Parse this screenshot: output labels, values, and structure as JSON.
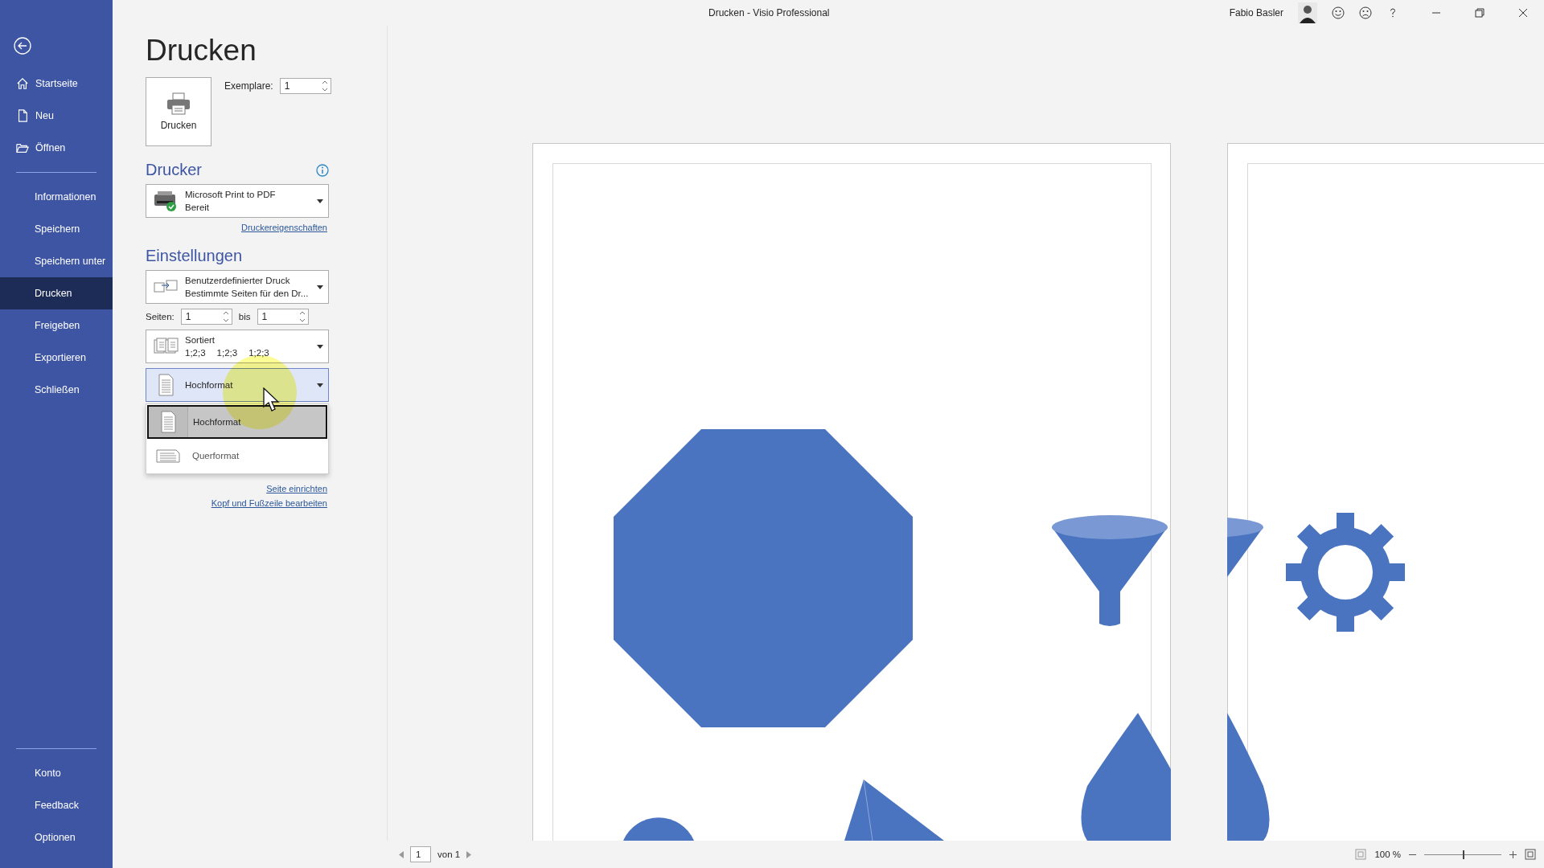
{
  "window": {
    "title": "Drucken  -  Visio Professional",
    "user": "Fabio Basler"
  },
  "sidebar": {
    "groups": [
      {
        "items": [
          {
            "label": "Startseite",
            "kind": "home",
            "selected": false
          },
          {
            "label": "Neu",
            "kind": "document",
            "selected": false
          },
          {
            "label": "Öffnen",
            "kind": "folder",
            "selected": false
          }
        ]
      },
      {
        "items": [
          {
            "label": "Informationen",
            "kind": "plain",
            "selected": false
          },
          {
            "label": "Speichern",
            "kind": "plain",
            "selected": false
          },
          {
            "label": "Speichern unter",
            "kind": "plain",
            "selected": false
          },
          {
            "label": "Drucken",
            "kind": "plain",
            "selected": true
          },
          {
            "label": "Freigeben",
            "kind": "plain",
            "selected": false
          },
          {
            "label": "Exportieren",
            "kind": "plain",
            "selected": false
          },
          {
            "label": "Schließen",
            "kind": "plain",
            "selected": false
          }
        ]
      },
      {
        "items": [
          {
            "label": "Konto",
            "kind": "plain",
            "selected": false
          },
          {
            "label": "Feedback",
            "kind": "plain",
            "selected": false
          },
          {
            "label": "Optionen",
            "kind": "plain",
            "selected": false
          }
        ]
      }
    ]
  },
  "page_title": "Drucken",
  "print_button": {
    "label": "Drucken"
  },
  "copies": {
    "label": "Exemplare:",
    "value": "1"
  },
  "printer": {
    "heading": "Drucker",
    "name": "Microsoft Print to PDF",
    "status": "Bereit",
    "properties_link": "Druckereigenschaften"
  },
  "settings": {
    "heading": "Einstellungen",
    "print_range": {
      "title": "Benutzerdefinierter Druck",
      "subtitle": "Bestimmte Seiten für den Dr..."
    },
    "pages": {
      "label": "Seiten:",
      "from": "1",
      "to_label": "bis",
      "to": "1"
    },
    "collation": {
      "title": "Sortiert",
      "samples": [
        "1;2;3",
        "1;2;3",
        "1;2;3"
      ]
    },
    "orientation": {
      "value": "Hochformat",
      "expanded": true,
      "options": [
        {
          "label": "Hochformat",
          "kind": "portrait",
          "selected": true
        },
        {
          "label": "Querformat",
          "kind": "landscape",
          "selected": false
        }
      ]
    },
    "links": [
      "Seite einrichten",
      "Kopf und Fußzeile bearbeiten"
    ]
  },
  "status_bar": {
    "page": "1",
    "page_of": "von 1",
    "zoom": "100 %",
    "zoom_slider": {
      "level": 0.5
    }
  }
}
